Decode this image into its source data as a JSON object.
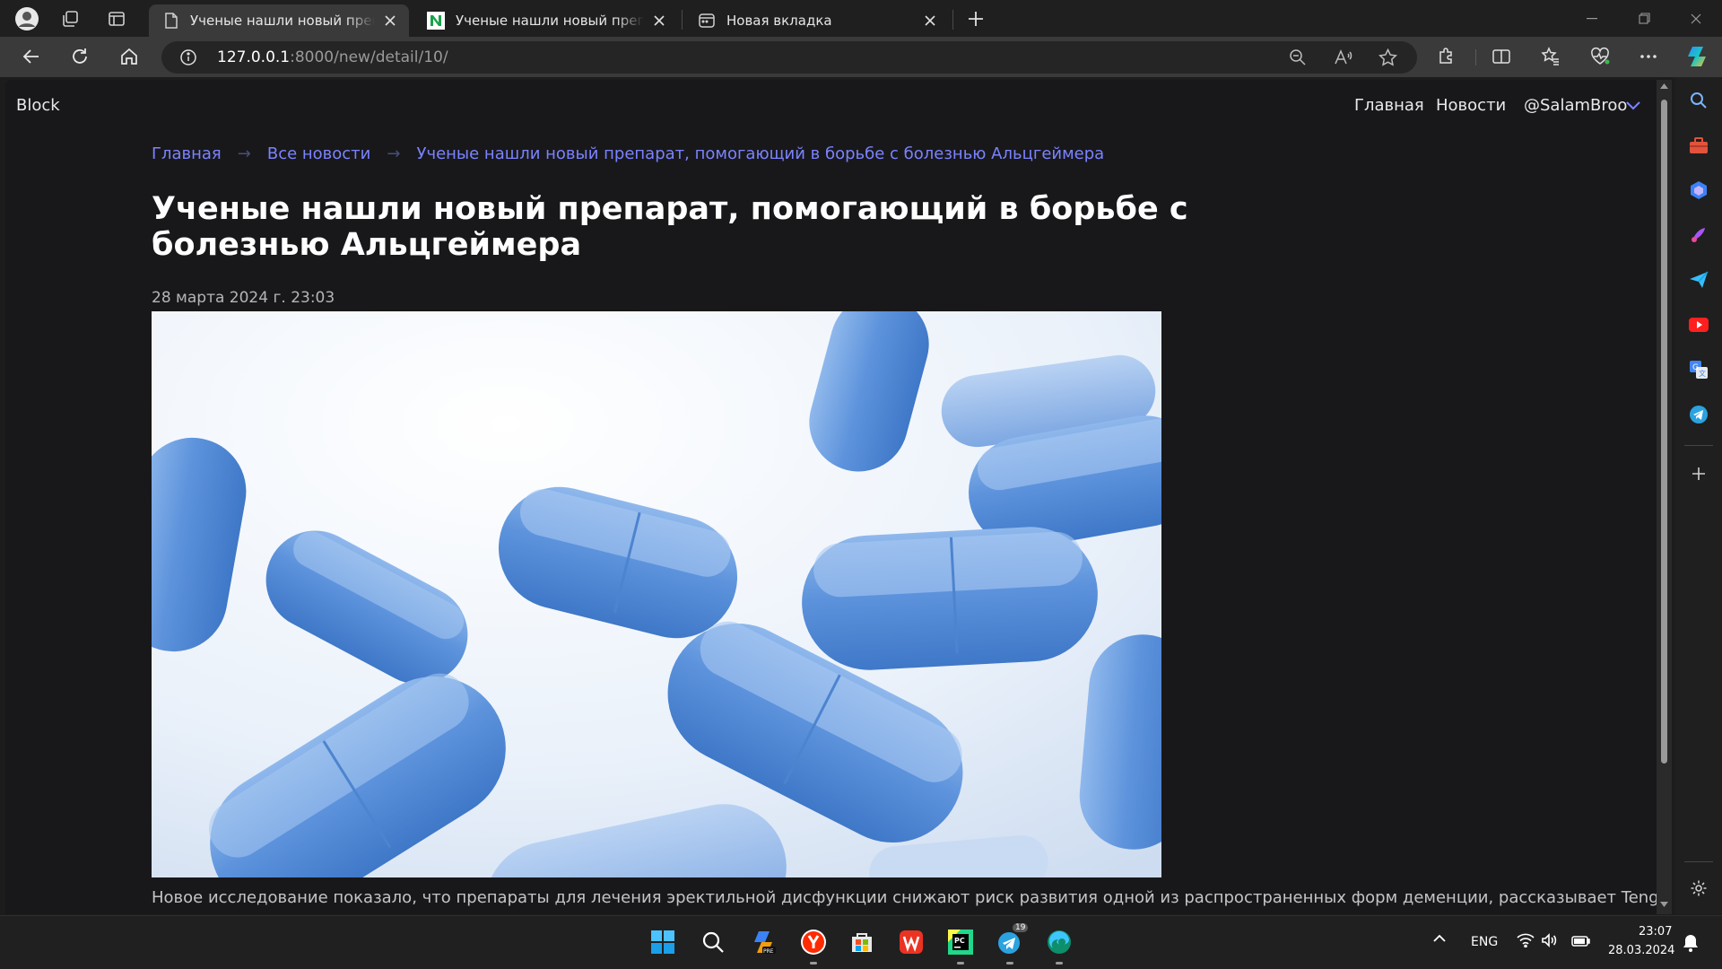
{
  "browser": {
    "tabs": [
      {
        "title": "Ученые нашли новый препарат, помогающий в борьбе с болезнью Альцгеймера",
        "icon": "page-icon",
        "active": true
      },
      {
        "title": "Ученые нашли новый препарат, помогающий в борьбе с болезнью Альцгеймера",
        "icon": "news-site-icon",
        "active": false
      },
      {
        "title": "Новая вкладка",
        "icon": "new-tab-icon",
        "active": false
      }
    ],
    "address": {
      "host": "127.0.0.1",
      "path": ":8000/new/detail/10/"
    }
  },
  "site": {
    "brand": "Block",
    "nav": {
      "home": "Главная",
      "news": "Новости",
      "user": "@SalamBroo"
    }
  },
  "breadcrumb": {
    "home": "Главная",
    "all_news": "Все новости",
    "current": "Ученые нашли новый препарат, помогающий в борьбе с болезнью Альцгеймера",
    "separator": "→"
  },
  "article": {
    "headline": "Ученые нашли новый препарат, помогающий в борьбе с болезнью Альцгеймера",
    "date": "28 марта 2024 г. 23:03",
    "image": "blue-pills-photo",
    "lead": "Новое исследование показало, что препараты для лечения эректильной дисфункции снижают риск развития одной из распространенных форм деменции, рассказывает Tengri Life"
  },
  "taskbar": {
    "apps": [
      "start-icon",
      "search-icon",
      "copilot-pre-icon",
      "yandex-browser-icon",
      "microsoft-store-icon",
      "wps-office-icon",
      "pycharm-icon",
      "telegram-icon",
      "edge-icon"
    ],
    "telegram_badge": "19",
    "language": "ENG",
    "time": "23:07",
    "date": "28.03.2024"
  },
  "colors": {
    "accent_link": "#7b83ff",
    "page_bg": "#18181b"
  }
}
